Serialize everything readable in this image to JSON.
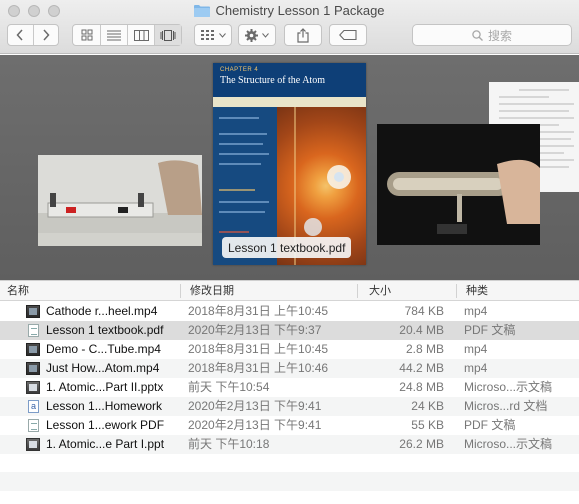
{
  "window": {
    "title": "Chemistry Lesson 1 Package"
  },
  "toolbar": {
    "search_placeholder": "搜索"
  },
  "coverflow": {
    "selected_label": "Lesson 1 textbook.pdf",
    "book": {
      "chapter": "CHAPTER 4",
      "title": "The Structure of the Atom"
    }
  },
  "columns": {
    "name": "名称",
    "date": "修改日期",
    "size": "大小",
    "kind": "种类"
  },
  "files": [
    {
      "name": "Cathode r...heel.mp4",
      "date": "2018年8月31日 上午10:45",
      "size": "784 KB",
      "kind": "mp4",
      "icon": "video-file-icon"
    },
    {
      "name": "Lesson 1 textbook.pdf",
      "date": "2020年2月13日 下午9:37",
      "size": "20.4 MB",
      "kind": "PDF 文稿",
      "icon": "pdf-file-icon"
    },
    {
      "name": "Demo - C...Tube.mp4",
      "date": "2018年8月31日 上午10:45",
      "size": "2.8 MB",
      "kind": "mp4",
      "icon": "video-file-icon"
    },
    {
      "name": "Just How...Atom.mp4",
      "date": "2018年8月31日 上午10:46",
      "size": "44.2 MB",
      "kind": "mp4",
      "icon": "video-file-icon"
    },
    {
      "name": "1. Atomic...Part II.pptx",
      "date": "前天 下午10:54",
      "size": "24.8 MB",
      "kind": "Microso...示文稿",
      "icon": "pptx-file-icon"
    },
    {
      "name": "Lesson 1...Homework",
      "date": "2020年2月13日 下午9:41",
      "size": "24 KB",
      "kind": "Micros...rd 文档",
      "icon": "word-file-icon"
    },
    {
      "name": "Lesson 1...ework PDF",
      "date": "2020年2月13日 下午9:41",
      "size": "55 KB",
      "kind": "PDF 文稿",
      "icon": "pdf-file-icon"
    },
    {
      "name": "1. Atomic...e Part I.ppt",
      "date": "前天 下午10:18",
      "size": "26.2 MB",
      "kind": "Microso...示文稿",
      "icon": "ppt-file-icon"
    }
  ]
}
